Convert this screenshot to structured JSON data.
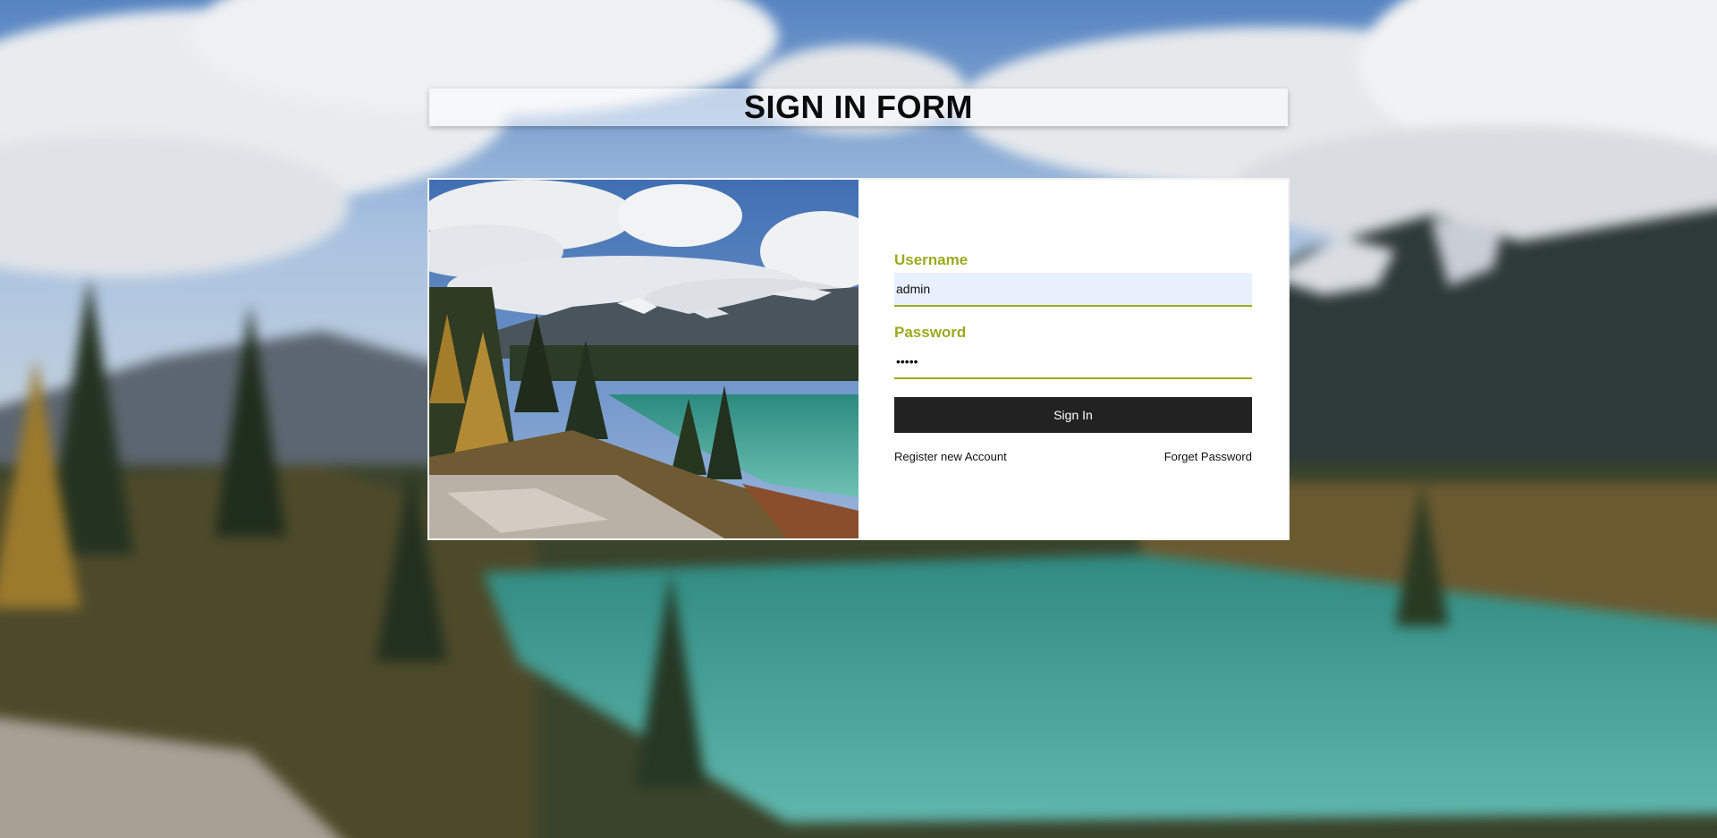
{
  "page": {
    "title": "SIGN IN FORM"
  },
  "form": {
    "username_label": "Username",
    "username_value": "admin",
    "password_label": "Password",
    "password_value": "•••••",
    "signin_label": "Sign In",
    "register_link": "Register new Account",
    "forgot_link": "Forget Password"
  },
  "theme": {
    "accent": "#9aaa1e",
    "button_bg": "#222222",
    "autofill_bg": "#e8f0fe"
  }
}
